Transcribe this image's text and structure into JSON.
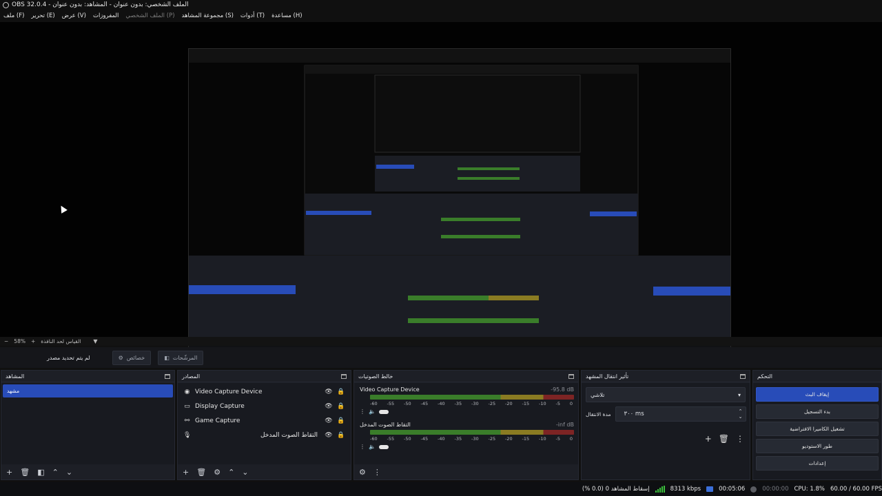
{
  "window": {
    "title": "OBS 32.0.4 - الملف الشخصي: بدون عنوان - المشاهد: بدون عنوان"
  },
  "menu": [
    "ملف (F)",
    "تحرير (E)",
    "عرض (V)",
    "المفروزات",
    "الملف الشخصي (P)",
    "مجموعة المشاهد (S)",
    "أدوات (T)",
    "مساعدة (H)"
  ],
  "preview": {
    "zoom": "58%",
    "scale_label": "القياس لحد النافذة"
  },
  "context": {
    "no_source": "لم يتم تحديد مصدر",
    "properties": "خصائص",
    "filters": "المرشّحات"
  },
  "scenes": {
    "title": "المشاهد",
    "items": [
      "مشهد"
    ]
  },
  "sources": {
    "title": "المصادر",
    "items": [
      {
        "name": "Video Capture Device",
        "icon": "camera-icon"
      },
      {
        "name": "Display Capture",
        "icon": "monitor-icon"
      },
      {
        "name": "Game Capture",
        "icon": "gamepad-icon"
      },
      {
        "name": "التقاط الصوت المدخل",
        "icon": "microphone-icon"
      }
    ]
  },
  "mixer": {
    "title": "خالط الصوتيات",
    "scale": [
      "-60",
      "-55",
      "-50",
      "-45",
      "-40",
      "-35",
      "-30",
      "-25",
      "-20",
      "-15",
      "-10",
      "-5",
      "0"
    ],
    "channels": [
      {
        "name": "Video Capture Device",
        "db": "-95.8 dB"
      },
      {
        "name": "التقاط الصوت المدخل",
        "db": "-inf dB"
      }
    ]
  },
  "transitions": {
    "title": "تأثير انتقال المشهد",
    "selected": "تلاشي",
    "duration_label": "مدة الانتقال",
    "duration": "٣٠٠ ms"
  },
  "controls": {
    "title": "التحكم",
    "buttons": [
      "إيقاف البث",
      "بدء التسجيل",
      "تشغيل الكاميرا الافتراضية",
      "طور الاستوديو",
      "إعدادات"
    ]
  },
  "status": {
    "dropped": "إسقاط المشاهد 0 (0.0 %)",
    "bitrate": "8313 kbps",
    "stream_time": "00:05:06",
    "rec_time": "00:00:00",
    "cpu": "CPU: 1.8%",
    "fps": "60.00 / 60.00 FPS",
    "colors": {
      "accent": "#284cb8",
      "net_ok": "#3bbf3b"
    }
  }
}
